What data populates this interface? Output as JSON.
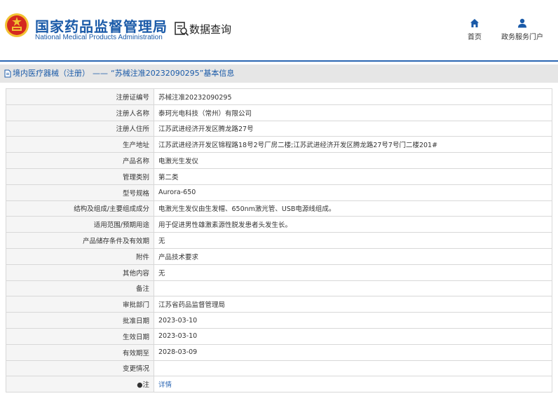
{
  "header": {
    "site_title_cn": "国家药品监督管理局",
    "site_title_en": "National Medical Products Administration",
    "query_label": "数据查询",
    "nav": [
      {
        "label": "首页",
        "icon": "home-icon"
      },
      {
        "label": "政务服务门户",
        "icon": "user-icon"
      }
    ]
  },
  "breadcrumb": {
    "main": "境内医疗器械（注册）",
    "separator": "——",
    "rest": "“苏械注准20232090295”基本信息"
  },
  "rows": [
    {
      "label": "注册证编号",
      "value": "苏械注准20232090295"
    },
    {
      "label": "注册人名称",
      "value": "泰珂光电科技（常州）有限公司"
    },
    {
      "label": "注册人住所",
      "value": "江苏武进经济开发区腾龙路27号"
    },
    {
      "label": "生产地址",
      "value": "江苏武进经济开发区锦程路18号2号厂房二楼;江苏武进经济开发区腾龙路27号7号门二楼201#"
    },
    {
      "label": "产品名称",
      "value": "电激光生发仪"
    },
    {
      "label": "管理类别",
      "value": "第二类"
    },
    {
      "label": "型号规格",
      "value": "Aurora-650"
    },
    {
      "label": "结构及组成/主要组成成分",
      "value": "电激光生发仪由生发帽、650nm激光管、USB电源线组成。"
    },
    {
      "label": "适用范围/预期用途",
      "value": "用于促进男性雄激素源性脱发患者头发生长。"
    },
    {
      "label": "产品储存条件及有效期",
      "value": "无"
    },
    {
      "label": "附件",
      "value": "产品技术要求"
    },
    {
      "label": "其他内容",
      "value": "无"
    },
    {
      "label": "备注",
      "value": ""
    },
    {
      "label": "审批部门",
      "value": "江苏省药品监督管理局"
    },
    {
      "label": "批准日期",
      "value": "2023-03-10"
    },
    {
      "label": "生效日期",
      "value": "2023-03-10"
    },
    {
      "label": "有效期至",
      "value": "2028-03-09"
    },
    {
      "label": "变更情况",
      "value": ""
    },
    {
      "label": "●注",
      "value": "详情",
      "is_link": true
    }
  ],
  "colors": {
    "brand_blue": "#1a5aa8",
    "header_line": "#2a66b3",
    "breadcrumb_bg": "#e6e6e6",
    "label_bg": "#f5f5f5",
    "border": "#d8d8d8",
    "emblem_red": "#d42a1f",
    "emblem_gold": "#f2c233"
  }
}
